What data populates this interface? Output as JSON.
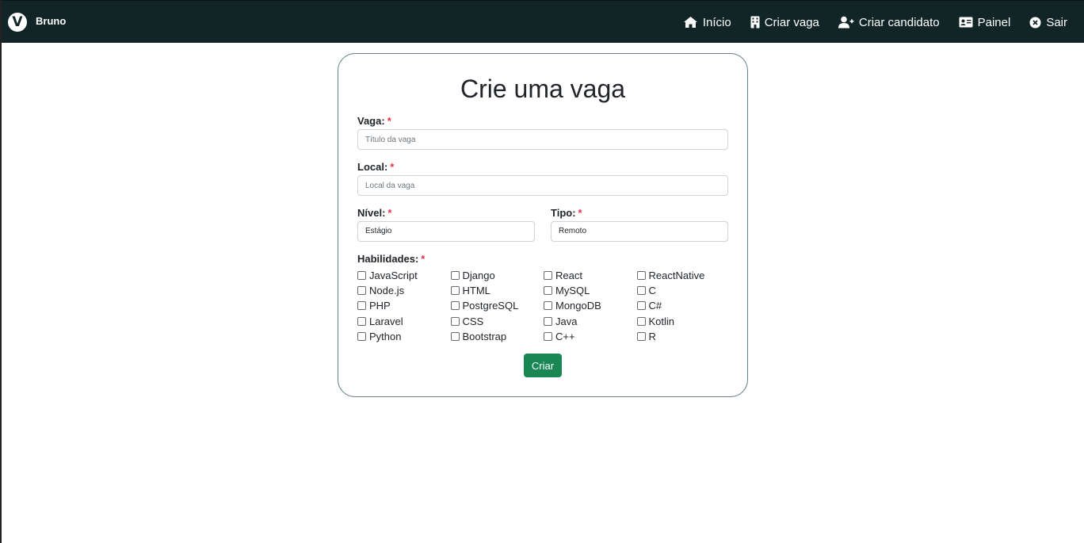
{
  "navbar": {
    "brand_logo": "V",
    "brand_name": "Bruno",
    "items": [
      {
        "label": "Início",
        "icon": "home-icon"
      },
      {
        "label": "Criar vaga",
        "icon": "building-icon"
      },
      {
        "label": "Criar candidato",
        "icon": "user-plus-icon"
      },
      {
        "label": "Painel",
        "icon": "id-card-icon"
      },
      {
        "label": "Sair",
        "icon": "close-circle-icon"
      }
    ]
  },
  "form": {
    "title": "Crie uma vaga",
    "required_mark": "*",
    "vaga": {
      "label": "Vaga:",
      "placeholder": "Título da vaga"
    },
    "local": {
      "label": "Local:",
      "placeholder": "Local da vaga"
    },
    "nivel": {
      "label": "Nível:",
      "value": "Estágio"
    },
    "tipo": {
      "label": "Tipo:",
      "value": "Remoto"
    },
    "habilidades": {
      "label": "Habilidades:",
      "rows": [
        [
          "JavaScript",
          "Django",
          "React",
          "ReactNative"
        ],
        [
          "Node.js",
          "HTML",
          "MySQL",
          "C"
        ],
        [
          "PHP",
          "PostgreSQL",
          "MongoDB",
          "C#"
        ],
        [
          "Laravel",
          "CSS",
          "Java",
          "Kotlin"
        ],
        [
          "Python",
          "Bootstrap",
          "C++",
          "R"
        ]
      ]
    },
    "submit_label": "Criar"
  },
  "colors": {
    "navbar_bg": "#112526",
    "card_border": "#5f7f86",
    "required": "#dc3545",
    "button": "#198754"
  }
}
